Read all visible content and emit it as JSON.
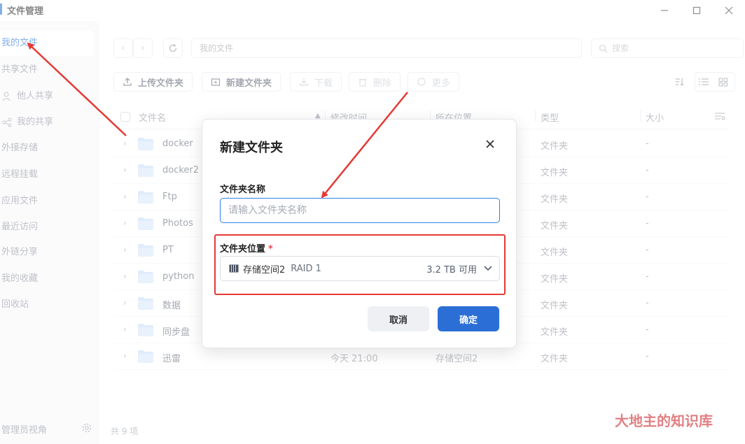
{
  "window": {
    "title": "文件管理",
    "minimize_label": "—",
    "maximize_label": "☐",
    "close_label": "✕"
  },
  "sidebar": {
    "items": [
      {
        "label": "我的文件",
        "icon": "",
        "active": true
      },
      {
        "label": "共享文件",
        "icon": ""
      },
      {
        "label": "他人共享",
        "icon": "person-icon"
      },
      {
        "label": "我的共享",
        "icon": "share-icon"
      },
      {
        "label": "外接存储",
        "icon": ""
      },
      {
        "label": "远程挂载",
        "icon": ""
      },
      {
        "label": "应用文件",
        "icon": ""
      },
      {
        "label": "最近访问",
        "icon": ""
      },
      {
        "label": "外链分享",
        "icon": ""
      },
      {
        "label": "我的收藏",
        "icon": ""
      },
      {
        "label": "回收站",
        "icon": ""
      }
    ],
    "footer_label": "管理员视角"
  },
  "toolbar": {
    "path": "我的文件",
    "search_placeholder": "搜索",
    "upload_label": "上传文件夹",
    "new_folder_label": "新建文件夹",
    "download_label": "下载",
    "delete_label": "删除",
    "more_label": "更多"
  },
  "table": {
    "headers": {
      "name": "文件名",
      "mtime": "修改时间",
      "location": "所在位置",
      "type": "类型",
      "size": "大小"
    },
    "rows": [
      {
        "name": "docker",
        "mtime": "",
        "location": "",
        "type": "文件夹",
        "size": "-"
      },
      {
        "name": "docker2",
        "mtime": "",
        "location": "",
        "type": "文件夹",
        "size": "-"
      },
      {
        "name": "Ftp",
        "mtime": "",
        "location": "",
        "type": "文件夹",
        "size": "-"
      },
      {
        "name": "Photos",
        "mtime": "",
        "location": "",
        "type": "文件夹",
        "size": "-"
      },
      {
        "name": "PT",
        "mtime": "",
        "location": "",
        "type": "文件夹",
        "size": "-"
      },
      {
        "name": "python",
        "mtime": "",
        "location": "",
        "type": "文件夹",
        "size": "-"
      },
      {
        "name": "数据",
        "mtime": "",
        "location": "",
        "type": "文件夹",
        "size": "-"
      },
      {
        "name": "同步盘",
        "mtime": "",
        "location": "",
        "type": "文件夹",
        "size": "-"
      },
      {
        "name": "迅雷",
        "mtime": "今天 21:00",
        "location": "存储空间2",
        "type": "文件夹",
        "size": "-"
      }
    ]
  },
  "status": {
    "count_text": "共 9 项"
  },
  "dialog": {
    "title": "新建文件夹",
    "name_label": "文件夹名称",
    "name_placeholder": "请输入文件夹名称",
    "name_value": "",
    "location_label": "文件夹位置",
    "required_mark": "*",
    "location_name": "存储空间2",
    "location_raid": "RAID 1",
    "location_capacity": "3.2 TB 可用",
    "cancel_label": "取消",
    "ok_label": "确定"
  },
  "watermark": "大地主的知识库",
  "colors": {
    "accent": "#1a6fd8",
    "primary_button": "#2b6fd6",
    "annotation_red": "#e53935",
    "folder": "#c7dcf7"
  }
}
